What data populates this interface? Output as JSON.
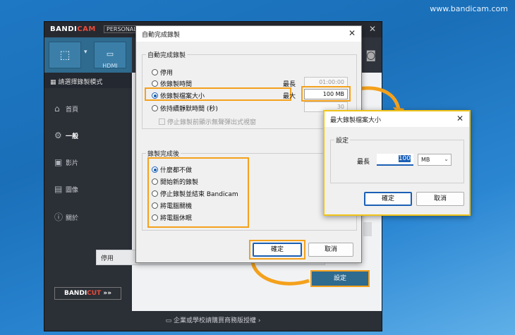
{
  "watermark": "www.bandicam.com",
  "main": {
    "logo_a": "BANDI",
    "logo_b": "CAM",
    "edition": "PERSONAL",
    "mode_label": "HDMI",
    "sidebar_header": "請選擇錄製模式",
    "nav": [
      {
        "label": "首頁",
        "icon": "home-icon"
      },
      {
        "label": "一般",
        "icon": "gear-icon"
      },
      {
        "label": "影片",
        "icon": "video-icon"
      },
      {
        "label": "圖像",
        "icon": "image-icon"
      },
      {
        "label": "關於",
        "icon": "info-icon"
      }
    ],
    "cut_a": "BANDI",
    "cut_b": "CUT",
    "cut_arrows": "»»",
    "status_value": "停用",
    "settings_button": "設定",
    "footer": "企業或學校請購買商務版授權 ›"
  },
  "dialog1": {
    "title": "自動完成錄製",
    "group1_label": "自動完成錄製",
    "opt_disabled": "停用",
    "opt_by_time": "依錄製時間",
    "opt_by_size": "依錄製檔案大小",
    "opt_by_silence": "依持續靜默時間 (秒)",
    "lbl_longest": "最長",
    "lbl_max": "最大",
    "time_value": "01:00:00",
    "size_value": "100 MB",
    "silence_value": "30",
    "chk_popup": "停止錄製前顯示無聲彈出式視窗",
    "group2_label": "錄製完成後",
    "after_options": [
      "什麼都不做",
      "開始新的錄製",
      "停止錄製並結束 Bandicam",
      "將電腦關機",
      "將電腦休眠"
    ],
    "ok": "確定",
    "cancel": "取消"
  },
  "dialog2": {
    "title": "最大錄製檔案大小",
    "group_label": "設定",
    "lbl_longest": "最長",
    "value": "100",
    "unit": "MB",
    "ok": "確定",
    "cancel": "取消"
  },
  "colors": {
    "highlight": "#f4a11c",
    "accent": "#1a5fb4"
  }
}
